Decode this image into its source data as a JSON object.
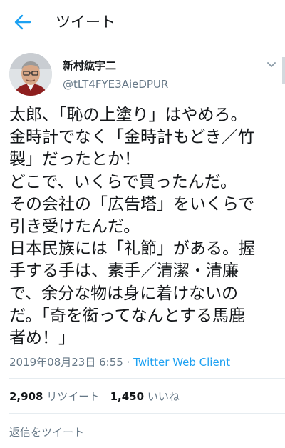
{
  "header": {
    "title": "ツイート"
  },
  "user": {
    "name": "新村紘宇二",
    "handle": "@tLT4FYE3AieDPUR"
  },
  "tweet": {
    "lines": [
      "太郎、「恥の上塗り」はやめろ。",
      "金時計でなく「金時計もどき／竹",
      "製」だったとか！",
      "どこで、いくらで買ったんだ。",
      "その会社の「広告塔」をいくらで",
      "引き受けたんだ。",
      "日本民族には「礼節」がある。握",
      "手する手は、素手／清潔・清廉",
      "で、余分な物は身に着けないの",
      "だ。「奇を衒ってなんとする馬鹿",
      "者め！」"
    ],
    "timestamp": "2019年08月23日 6:55",
    "separator": "·",
    "client": "Twitter Web Client"
  },
  "stats": {
    "retweets_count": "2,908",
    "retweets_label": "リツイート",
    "likes_count": "1,450",
    "likes_label": "いいね"
  },
  "reply": {
    "placeholder": "返信をツイート"
  },
  "colors": {
    "accent": "#1da1f2",
    "muted": "#657786",
    "text": "#14171a",
    "divider": "#e6ecf0"
  },
  "icons": {
    "back": "arrow-left-icon",
    "menu": "chevron-down-icon"
  }
}
